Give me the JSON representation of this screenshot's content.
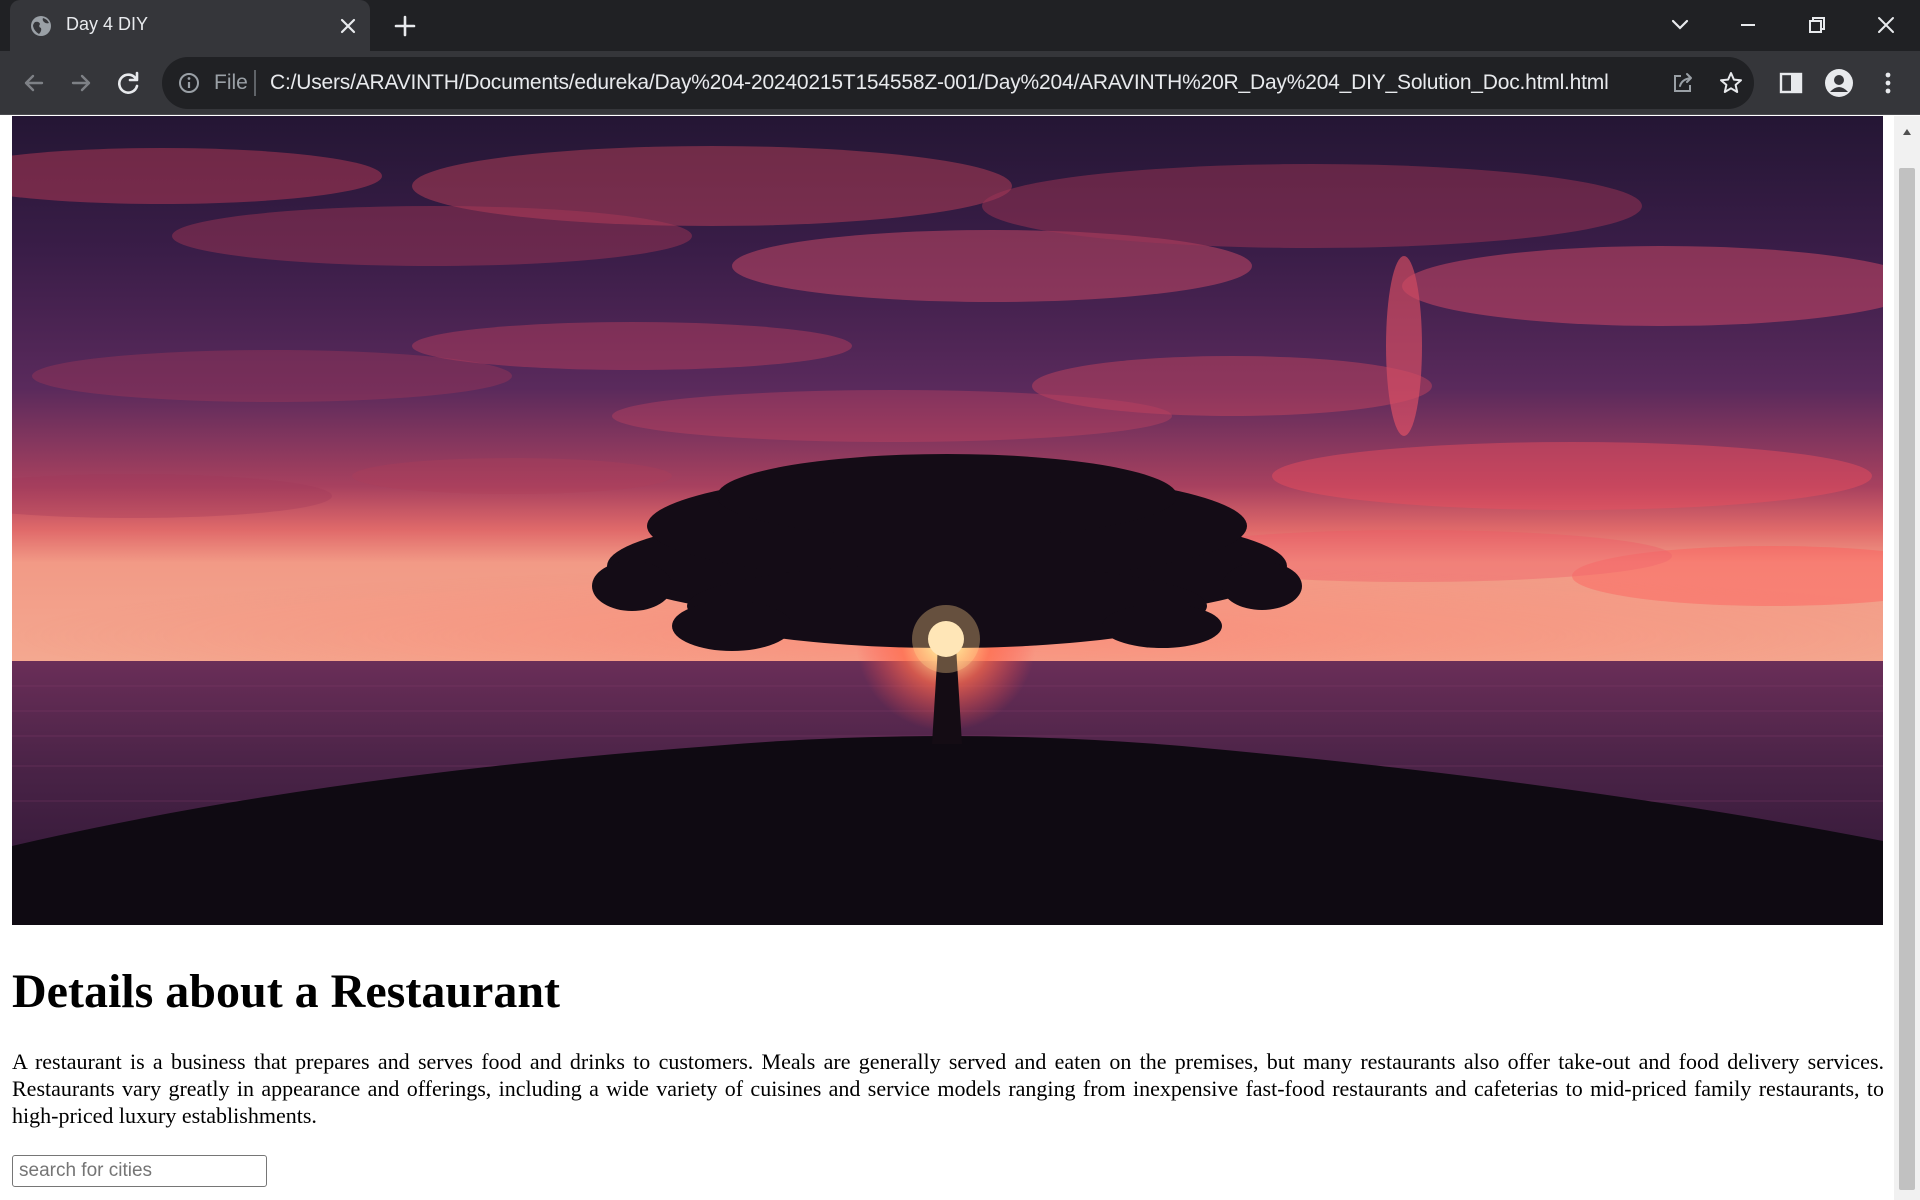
{
  "browser": {
    "tab_title": "Day 4 DIY",
    "omnibox": {
      "security_label": "File",
      "url": "C:/Users/ARAVINTH/Documents/edureka/Day%204-20240215T154558Z-001/Day%204/ARAVINTH%20R_Day%204_DIY_Solution_Doc.html.html"
    },
    "colors": {
      "tabstrip": "#202124",
      "toolbar": "#35363a",
      "omnibox": "#202124",
      "text": "#e8eaed"
    },
    "icons": [
      "globe-icon",
      "close-icon",
      "plus-icon",
      "chevron-down-icon",
      "minimize-icon",
      "restore-icon",
      "close-window-icon",
      "back-arrow-icon",
      "forward-arrow-icon",
      "reload-icon",
      "info-icon",
      "share-icon",
      "star-icon",
      "side-panel-icon",
      "profile-icon",
      "kebab-menu-icon"
    ]
  },
  "page": {
    "hero_image_alt": "",
    "heading": "Details about a Restaurant",
    "paragraph": "A restaurant is a business that prepares and serves food and drinks to customers. Meals are generally served and eaten on the premises, but many restaurants also offer take-out and food delivery services. Restaurants vary greatly in appearance and offerings, including a wide variety of cuisines and service models ranging from inexpensive fast-food restaurants and cafeterias to mid-priced family restaurants, to high-priced luxury establishments.",
    "search": {
      "placeholder": "search for cities",
      "value": ""
    }
  }
}
